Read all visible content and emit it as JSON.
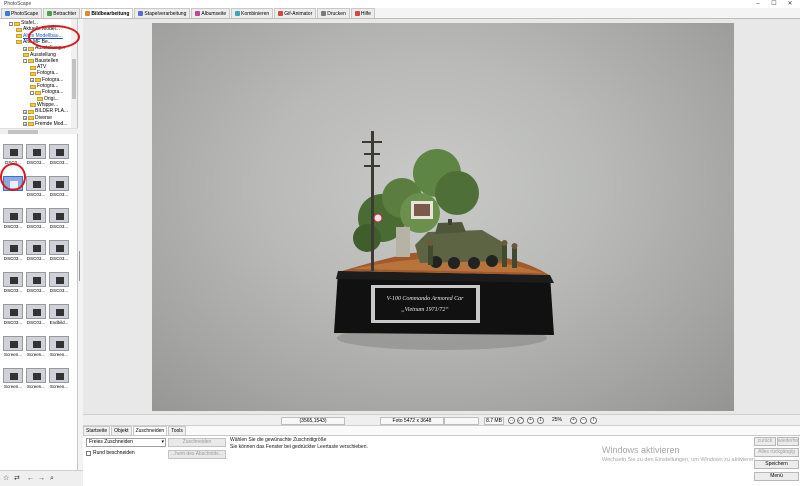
{
  "window": {
    "title": "PhotoScape",
    "minimize": "–",
    "maximize": "☐",
    "close": "✕"
  },
  "tabs": [
    {
      "label": "PhotoScape",
      "icon_color": "#3b7bd6",
      "active": false
    },
    {
      "label": "Betrachter",
      "icon_color": "#4c9e47",
      "active": false
    },
    {
      "label": "Bildbearbeitung",
      "icon_color": "#e0892b",
      "active": true
    },
    {
      "label": "Stapelverarbeitung",
      "icon_color": "#5b6bd1",
      "active": false
    },
    {
      "label": "Albumseite",
      "icon_color": "#c0468e",
      "active": false
    },
    {
      "label": "Kombinieren",
      "icon_color": "#3aa7b7",
      "active": false
    },
    {
      "label": "Gif-Animator",
      "icon_color": "#d64545",
      "active": false
    },
    {
      "label": "Drucken",
      "icon_color": "#7a7a7a",
      "active": false
    },
    {
      "label": "Hilfe",
      "icon_color": "#d64545",
      "active": false
    }
  ],
  "tree": {
    "nodes": [
      {
        "label": "Stafel...",
        "level": 1,
        "expander": "-"
      },
      {
        "label": "Aktuelle Model...",
        "level": 2,
        "expander": ""
      },
      {
        "label": "Altes Modellbau...",
        "level": 2,
        "expander": "",
        "link": true
      },
      {
        "label": "Alte MF Be...",
        "level": 2,
        "expander": ""
      },
      {
        "label": "Ausstellung...",
        "level": 3,
        "expander": "+"
      },
      {
        "label": "Ausstellung",
        "level": 3,
        "expander": ""
      },
      {
        "label": "Baustellen",
        "level": 3,
        "expander": "-"
      },
      {
        "label": "ATV",
        "level": 4,
        "expander": ""
      },
      {
        "label": "Fotogra...",
        "level": 4,
        "expander": ""
      },
      {
        "label": "Fotogra...",
        "level": 4,
        "expander": "+"
      },
      {
        "label": "Fotogra...",
        "level": 4,
        "expander": ""
      },
      {
        "label": "Fotogra...",
        "level": 4,
        "expander": "-"
      },
      {
        "label": "Origi...",
        "level": 5,
        "expander": ""
      },
      {
        "label": "Whippe...",
        "level": 4,
        "expander": ""
      },
      {
        "label": "BILDER PLA...",
        "level": 3,
        "expander": "+"
      },
      {
        "label": "Diverse",
        "level": 3,
        "expander": "+"
      },
      {
        "label": "Fremde Mod...",
        "level": 3,
        "expander": "+"
      }
    ]
  },
  "thumbnails": [
    {
      "caption": "DSC0...",
      "selected": false
    },
    {
      "caption": "DSC03...",
      "selected": false
    },
    {
      "caption": "DSC03...",
      "selected": false
    },
    {
      "caption": "",
      "selected": true
    },
    {
      "caption": "DSC03...",
      "selected": false
    },
    {
      "caption": "DSC03...",
      "selected": false
    },
    {
      "caption": "DSC03...",
      "selected": false
    },
    {
      "caption": "DSC03...",
      "selected": false
    },
    {
      "caption": "DSC03...",
      "selected": false
    },
    {
      "caption": "DSC03...",
      "selected": false
    },
    {
      "caption": "DSC03...",
      "selected": false
    },
    {
      "caption": "DSC03...",
      "selected": false
    },
    {
      "caption": "DSC03...",
      "selected": false
    },
    {
      "caption": "DSC03...",
      "selected": false
    },
    {
      "caption": "DSC03...",
      "selected": false
    },
    {
      "caption": "DSC03...",
      "selected": false
    },
    {
      "caption": "DSC03...",
      "selected": false
    },
    {
      "caption": "Endbild...",
      "selected": false
    },
    {
      "caption": "Screen...",
      "selected": false
    },
    {
      "caption": "Screen...",
      "selected": false
    },
    {
      "caption": "Screen...",
      "selected": false
    },
    {
      "caption": "Screen...",
      "selected": false
    },
    {
      "caption": "Screen...",
      "selected": false
    },
    {
      "caption": "Screen...",
      "selected": false
    }
  ],
  "photo": {
    "plaque_line1": "V-100 Commando Armored Car",
    "plaque_line2": "„Vietnam 1971/72“"
  },
  "status": {
    "coords": "(3565,1543)",
    "photo_size": "Foto 5472 x 3648",
    "file_size": "8.7 MB",
    "zoom": "25%"
  },
  "bottom_tabs": [
    {
      "label": "Startseite",
      "active": false
    },
    {
      "label": "Objekt",
      "active": false
    },
    {
      "label": "Zuschneiden",
      "active": true
    },
    {
      "label": "Tools",
      "active": false
    }
  ],
  "crop": {
    "mode_select": "Freies Zuschneiden",
    "round_crop_label": "Rund beschneiden",
    "crop_button": "Zuschneiden",
    "save_selection_button": "...hem des Abschnitts...",
    "info_line1": "Wählen Sie die gewünschte Zuschnittgröße",
    "info_line2": "Sie können das Fenster bei gedrückter Leertaste verschieben."
  },
  "activation": {
    "title": "Windows aktivieren",
    "subtitle": "Wechseln Sie zu den Einstellungen, um Windows zu aktivieren."
  },
  "right_buttons": {
    "back": "zurück",
    "redo": "wiederho...",
    "undo_all": "Alles rückgängig",
    "save": "Speichern",
    "menu": "Menü"
  },
  "leftbar_icons": [
    "☆",
    "⇄",
    "←",
    "→",
    "⌕"
  ]
}
